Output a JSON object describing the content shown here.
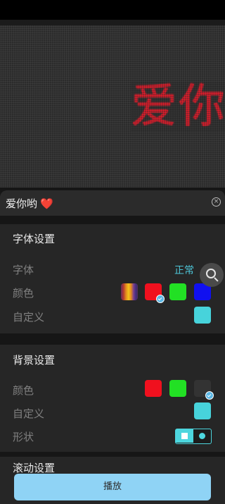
{
  "led_preview": {
    "text": "爱你哟",
    "text_color": "#e81c2c"
  },
  "input": {
    "value": "爱你哟",
    "emoji": "❤️"
  },
  "font_settings": {
    "title": "字体设置",
    "font_label": "字体",
    "font_value": "正常",
    "color_label": "颜色",
    "custom_label": "自定义",
    "swatches": [
      "rainbow",
      "#f0101e",
      "#22e024",
      "#1010f0"
    ],
    "selected_swatch": "#f0101e",
    "custom_color": "#47d3db"
  },
  "background_settings": {
    "title": "背景设置",
    "color_label": "颜色",
    "custom_label": "自定义",
    "shape_label": "形状",
    "swatches": [
      "#f0101e",
      "#22e024",
      "#333333"
    ],
    "selected_swatch": "#333333",
    "custom_color": "#47d3db",
    "shape_options": [
      "square",
      "circle"
    ],
    "selected_shape": "square"
  },
  "scroll_settings": {
    "title": "滚动设置"
  },
  "play_button": {
    "label": "播放"
  }
}
